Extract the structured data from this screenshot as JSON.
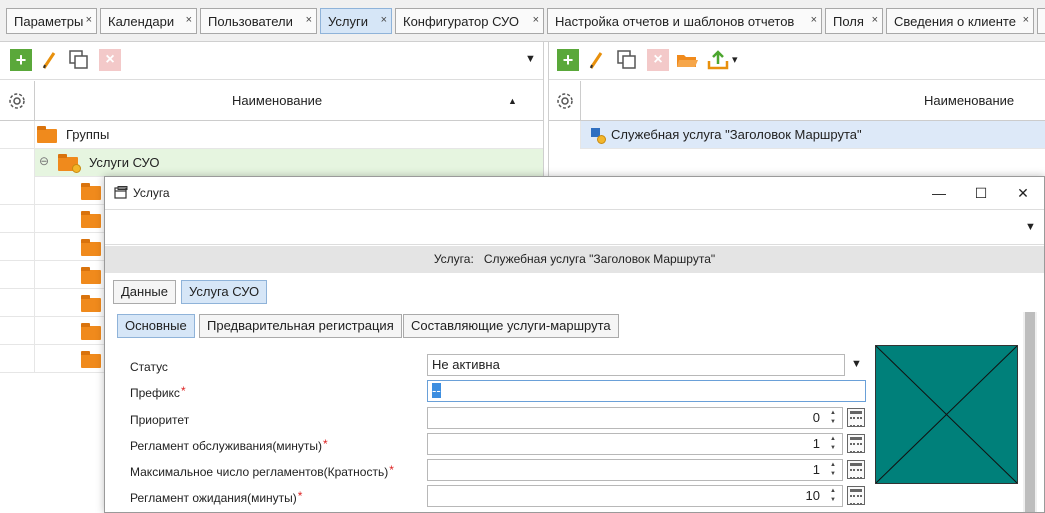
{
  "tabs": [
    {
      "label": "Параметры",
      "close": "×"
    },
    {
      "label": "Календари",
      "close": "×"
    },
    {
      "label": "Пользователи",
      "close": "×"
    },
    {
      "label": "Услуги",
      "close": "×"
    },
    {
      "label": "Конфигуратор СУО",
      "close": "×"
    },
    {
      "label": "Настройка отчетов и шаблонов отчетов",
      "close": "×"
    },
    {
      "label": "Поля",
      "close": "×"
    },
    {
      "label": "Сведения о клиенте",
      "close": "×"
    }
  ],
  "active_tab_index": 3,
  "left_panel": {
    "column_header": "Наименование",
    "sort_indicator": "▲",
    "dropdown_arrow": "▼",
    "rows": [
      {
        "label": "Группы"
      },
      {
        "label": "Услуги СУО",
        "expander": "⊖"
      }
    ]
  },
  "right_panel": {
    "column_header": "Наименование",
    "dropdown_arrow": "▾",
    "rows": [
      {
        "label": "Служебная услуга \"Заголовок Маршрута\""
      }
    ]
  },
  "dialog": {
    "title": "Услуга",
    "minimize": "—",
    "maximize": "☐",
    "close": "✕",
    "toolbar_dropdown": "▼",
    "caption_label": "Услуга:",
    "caption_value": "Служебная услуга \"Заголовок Маршрута\"",
    "tabs": [
      {
        "label": "Данные"
      },
      {
        "label": "Услуга СУО"
      }
    ],
    "subtabs": [
      {
        "label": "Основные"
      },
      {
        "label": "Предварительная регистрация"
      },
      {
        "label": "Составляющие услуги-маршрута"
      }
    ],
    "form": {
      "status_label": "Статус",
      "status_value": "Не активна",
      "status_dropdown": "▼",
      "prefix_label": "Префикс",
      "prefix_value": "--",
      "priority_label": "Приоритет",
      "priority_value": "0",
      "service_reg_label": "Регламент обслуживания(минуты)",
      "service_reg_value": "1",
      "max_reg_label": "Максимальное число регламентов(Кратность)",
      "max_reg_value": "1",
      "wait_reg_label": "Регламент ожидания(минуты)",
      "wait_reg_value": "10",
      "required_mark": "*",
      "spin_up": "▲",
      "spin_down": "▼"
    },
    "image_placeholder_color": "#00807a"
  }
}
